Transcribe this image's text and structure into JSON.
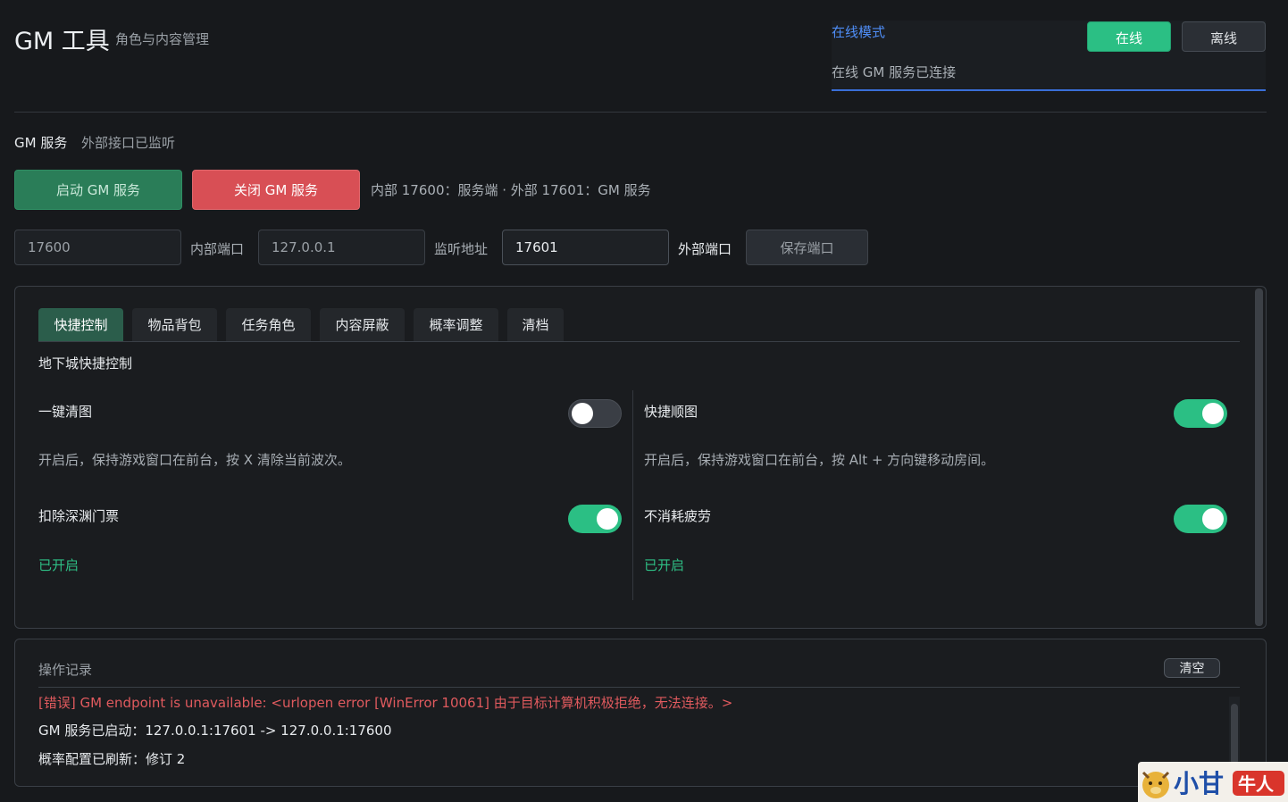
{
  "header": {
    "title": "GM 工具",
    "subtitle": "角色与内容管理"
  },
  "mode": {
    "label": "在线模式",
    "online_label": "在线",
    "offline_label": "离线",
    "status": "在线 GM 服务已连接",
    "selected": "在线",
    "accent_color": "#2bbf84",
    "link_color": "#4f8ef7"
  },
  "service": {
    "title": "GM 服务",
    "status": "外部接口已监听",
    "start_label": "启动 GM 服务",
    "stop_label": "关闭 GM 服务",
    "port_info": "内部 17600：服务端 · 外部 17601：GM 服务",
    "start_color": "#2a7d58",
    "stop_color": "#d84f55"
  },
  "ports": {
    "internal_value": "17600",
    "internal_label": "内部端口",
    "listen_value": "127.0.0.1",
    "listen_label": "监听地址",
    "external_value": "17601",
    "external_label": "外部端口",
    "save_label": "保存端口"
  },
  "tabs": [
    {
      "label": "快捷控制",
      "active": true
    },
    {
      "label": "物品背包",
      "active": false
    },
    {
      "label": "任务角色",
      "active": false
    },
    {
      "label": "内容屏蔽",
      "active": false
    },
    {
      "label": "概率调整",
      "active": false
    },
    {
      "label": "清档",
      "active": false
    }
  ],
  "quick_control": {
    "section_title": "地下城快捷控制",
    "options": [
      {
        "label": "一键清图",
        "enabled": false,
        "description": "开启后，保持游戏窗口在前台，按 X 清除当前波次。"
      },
      {
        "label": "快捷顺图",
        "enabled": true,
        "description": "开启后，保持游戏窗口在前台，按 Alt + 方向键移动房间。"
      },
      {
        "label": "扣除深渊门票",
        "enabled": true,
        "description": "已开启"
      },
      {
        "label": "不消耗疲劳",
        "enabled": true,
        "description": "已开启"
      }
    ]
  },
  "log": {
    "title": "操作记录",
    "clear_label": "清空",
    "entries": [
      {
        "level": "error",
        "text": "[错误] GM endpoint is unavailable: <urlopen error [WinError 10061] 由于目标计算机积极拒绝，无法连接。>"
      },
      {
        "level": "info",
        "text": "GM 服务已启动：127.0.0.1:17601 -> 127.0.0.1:17600"
      },
      {
        "level": "info",
        "text": "概率配置已刷新：修订 2"
      }
    ]
  },
  "watermark": {
    "text": "小甘牛人"
  }
}
